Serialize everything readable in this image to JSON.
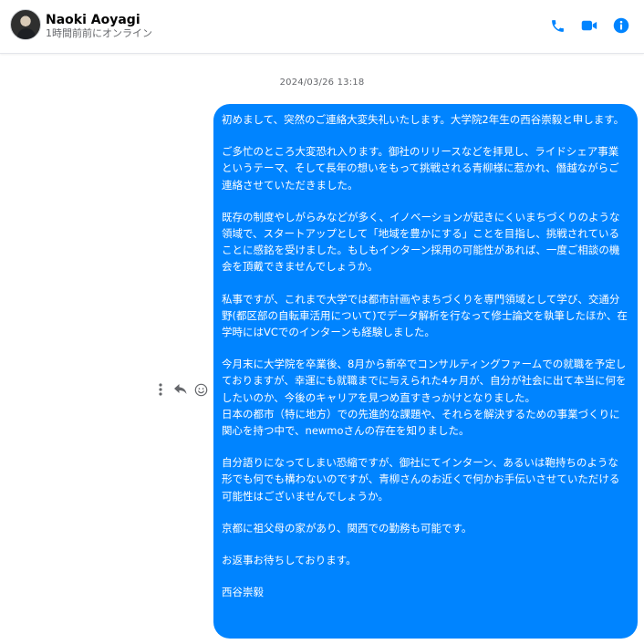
{
  "header": {
    "contact_name": "Naoki Aoyagi",
    "presence": "1時間前前にオンライン",
    "accent_color": "#0084ff"
  },
  "thread": {
    "timestamp": "2024/03/26 13:18",
    "message": {
      "paragraphs": [
        "初めまして、突然のご連絡大変失礼いたします。大学院2年生の西谷崇毅と申します。",
        "ご多忙のところ大変恐れ入ります。御社のリリースなどを拝見し、ライドシェア事業というテーマ、そして長年の想いをもって挑戦される青柳様に惹かれ、僭越ながらご連絡させていただきました。",
        "既存の制度やしがらみなどが多く、イノベーションが起きにくいまちづくりのような領域で、スタートアップとして「地域を豊かにする」ことを目指し、挑戦されていることに感銘を受けました。もしもインターン採用の可能性があれば、一度ご相談の機会を頂戴できませんでしょうか。",
        "私事ですが、これまで大学では都市計画やまちづくりを専門領域として学び、交通分野(都区部の自転車活用について)でデータ解析を行なって修士論文を執筆したほか、在学時にはVCでのインターンも経験しました。",
        "今月末に大学院を卒業後、8月から新卒でコンサルティングファームでの就職を予定しておりますが、幸運にも就職までに与えられた4ヶ月が、自分が社会に出て本当に何をしたいのか、今後のキャリアを見つめ直すきっかけとなりました。\n日本の都市（特に地方）での先進的な課題や、それらを解決するための事業づくりに関心を持つ中で、newmoさんの存在を知りました。",
        "自分語りになってしまい恐縮ですが、御社にてインターン、あるいは鞄持ちのような形でも何でも構わないのですが、青柳さんのお近くで何かお手伝いさせていただける可能性はございませんでしょうか。",
        "京都に祖父母の家があり、関西での勤務も可能です。",
        "お返事お待ちしております。",
        "西谷崇毅"
      ]
    },
    "message_actions": {
      "more_icon": "vertical-dots-icon",
      "reply_icon": "reply-arrow-icon",
      "react_icon": "smiley-icon"
    }
  }
}
